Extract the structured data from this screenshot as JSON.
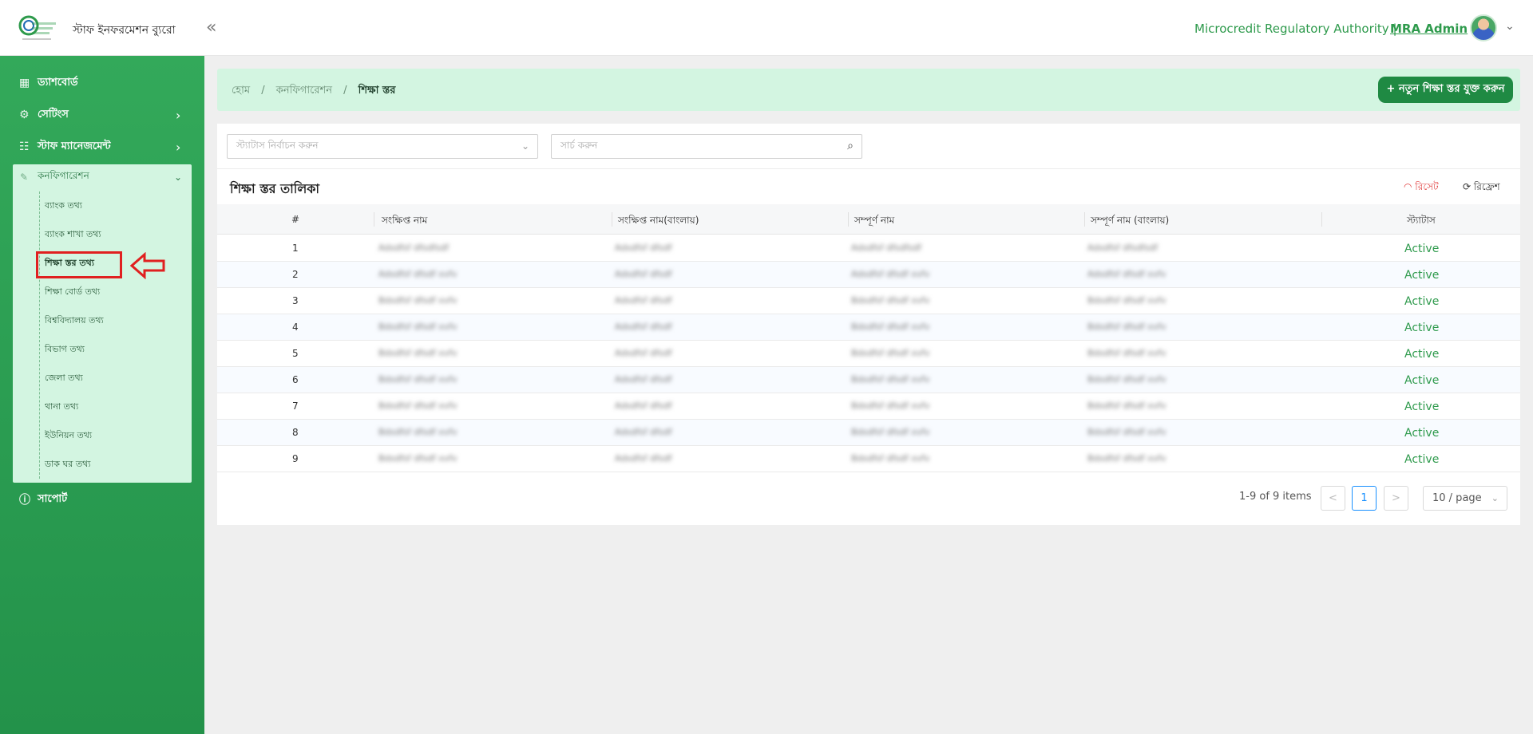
{
  "header": {
    "site_name": "স্টাফ ইনফরমেশন ব্যুরো",
    "collapse_icon": "«",
    "org": "Microcredit Regulatory Authority |",
    "user": "MRA Admin",
    "user_menu_icon": "⌄"
  },
  "sidebar": {
    "dashboard": "ড্যাশবোর্ড",
    "settings": "সেটিংস",
    "staff": "স্টাফ ম্যানেজমেন্ট",
    "config": "কনফিগারেশন",
    "support": "সাপোর্ট",
    "sub_items": [
      "ব্যাংক তথ্য",
      "ব্যাংক শাখা তথ্য",
      "শিক্ষা স্তর তথ্য",
      "শিক্ষা বোর্ড তথ্য",
      "বিশ্ববিদ্যালয় তথ্য",
      "বিভাগ তথ্য",
      "জেলা তথ্য",
      "থানা তথ্য",
      "ইউনিয়ন তথ্য",
      "ডাক ঘর তথ্য"
    ]
  },
  "breadcrumb": {
    "home": "হোম",
    "sep": "/",
    "config": "কনফিগারেশন",
    "current": "শিক্ষা স্তর"
  },
  "add_button": "+ নতুন শিক্ষা স্তর যুক্ত করুন",
  "filters": {
    "status_placeholder": "স্ট্যাটাস নির্বাচন করুন",
    "search_placeholder": "সার্চ করুন"
  },
  "table": {
    "title": "শিক্ষা স্তর তালিকা",
    "reset": "রিসেট",
    "refresh": "রিফ্রেশ",
    "headers": [
      "#",
      "সংক্ষিপ্ত নাম",
      "সংক্ষিপ্ত নাম(বাংলায়)",
      "সম্পূর্ণ নাম",
      "সম্পূর্ণ নাম (বাংলায়)",
      "স্ট্যাটাস"
    ],
    "rows": [
      [
        "1",
        "Adsdfsf dfsdfsdf",
        "Adsdfsf dfsdf",
        "Adsdfsf dfsdfsdf",
        "Adsdfsf dfsdfsdf",
        "Active"
      ],
      [
        "2",
        "Adsdfsf dfsdf xvfv",
        "Adsdfsf dfsdf",
        "Adsdfsf dfsdf xvfv",
        "Adsdfsf dfsdf xvfv",
        "Active"
      ],
      [
        "3",
        "Bdsdfsf dfsdf xvfv",
        "Adsdfsf dfsdf",
        "Bdsdfsf dfsdf xvfv",
        "Bdsdfsf dfsdf xvfv",
        "Active"
      ],
      [
        "4",
        "Bdsdfsf dfsdf xvfv",
        "Adsdfsf dfsdf",
        "Bdsdfsf dfsdf xvfv",
        "Bdsdfsf dfsdf xvfv",
        "Active"
      ],
      [
        "5",
        "Bdsdfsf dfsdf xvfv",
        "Adsdfsf dfsdf",
        "Bdsdfsf dfsdf xvfv",
        "Bdsdfsf dfsdf xvfv",
        "Active"
      ],
      [
        "6",
        "Bdsdfsf dfsdf xvfv",
        "Adsdfsf dfsdf",
        "Bdsdfsf dfsdf xvfv",
        "Bdsdfsf dfsdf xvfv",
        "Active"
      ],
      [
        "7",
        "Bdsdfsf dfsdf xvfv",
        "Adsdfsf dfsdf",
        "Bdsdfsf dfsdf xvfv",
        "Bdsdfsf dfsdf xvfv",
        "Active"
      ],
      [
        "8",
        "Bdsdfsf dfsdf xvfv",
        "Adsdfsf dfsdf",
        "Bdsdfsf dfsdf xvfv",
        "Bdsdfsf dfsdf xvfv",
        "Active"
      ],
      [
        "9",
        "Bdsdfsf dfsdf xvfv",
        "Adsdfsf dfsdf",
        "Bdsdfsf dfsdf xvfv",
        "Bdsdfsf dfsdf xvfv",
        "Active"
      ]
    ]
  },
  "pagination": {
    "info": "1-9 of 9 items",
    "prev": "<",
    "current": "1",
    "next": ">",
    "page_size": "10 / page"
  },
  "colors": {
    "brand": "#2e9a4c",
    "sidebar": "#2a9e52",
    "accent_light": "#d3f5e1",
    "button": "#1f8a43"
  }
}
